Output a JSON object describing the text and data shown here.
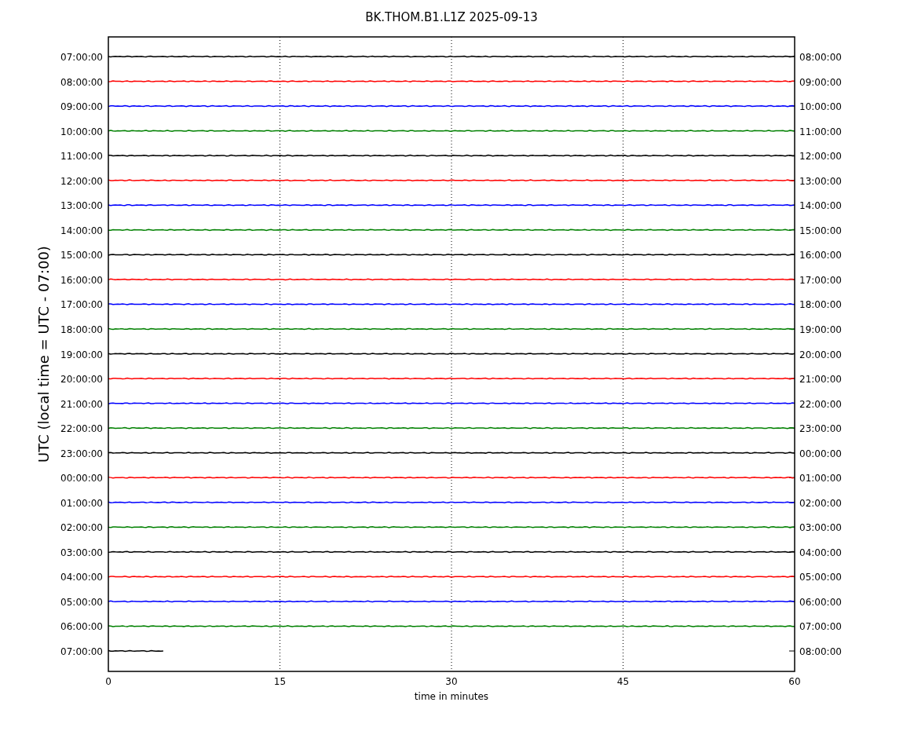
{
  "title": "BK.THOM.B1.L1Z 2025-09-13",
  "ylabel": "UTC (local time = UTC - 07:00)",
  "xlabel": "time in minutes",
  "xticks": [
    "0",
    "15",
    "30",
    "45",
    "60"
  ],
  "rows": [
    {
      "left": "07:00:00",
      "right": "08:00:00",
      "color": "#000000",
      "level": 1
    },
    {
      "left": "08:00:00",
      "right": "09:00:00",
      "color": "#ff0000",
      "level": 1
    },
    {
      "left": "09:00:00",
      "right": "10:00:00",
      "color": "#0000ff",
      "level": 1
    },
    {
      "left": "10:00:00",
      "right": "11:00:00",
      "color": "#008000",
      "level": 1
    },
    {
      "left": "11:00:00",
      "right": "12:00:00",
      "color": "#000000",
      "level": 1
    },
    {
      "left": "12:00:00",
      "right": "13:00:00",
      "color": "#ff0000",
      "level": 1
    },
    {
      "left": "13:00:00",
      "right": "14:00:00",
      "color": "#0000ff",
      "level": 1
    },
    {
      "left": "14:00:00",
      "right": "15:00:00",
      "color": "#008000",
      "level": 1
    },
    {
      "left": "15:00:00",
      "right": "16:00:00",
      "color": "#000000",
      "level": 1
    },
    {
      "left": "16:00:00",
      "right": "17:00:00",
      "color": "#ff0000",
      "level": 1
    },
    {
      "left": "17:00:00",
      "right": "18:00:00",
      "color": "#0000ff",
      "level": 1
    },
    {
      "left": "18:00:00",
      "right": "19:00:00",
      "color": "#008000",
      "level": 1
    },
    {
      "left": "19:00:00",
      "right": "20:00:00",
      "color": "#000000",
      "level": 1
    },
    {
      "left": "20:00:00",
      "right": "21:00:00",
      "color": "#ff0000",
      "level": 1
    },
    {
      "left": "21:00:00",
      "right": "22:00:00",
      "color": "#0000ff",
      "level": 1
    },
    {
      "left": "22:00:00",
      "right": "23:00:00",
      "color": "#008000",
      "level": 1
    },
    {
      "left": "23:00:00",
      "right": "00:00:00",
      "color": "#000000",
      "level": 1
    },
    {
      "left": "00:00:00",
      "right": "01:00:00",
      "color": "#ff0000",
      "level": 1
    },
    {
      "left": "01:00:00",
      "right": "02:00:00",
      "color": "#0000ff",
      "level": 1
    },
    {
      "left": "02:00:00",
      "right": "03:00:00",
      "color": "#008000",
      "level": 1
    },
    {
      "left": "03:00:00",
      "right": "04:00:00",
      "color": "#000000",
      "level": 1
    },
    {
      "left": "04:00:00",
      "right": "05:00:00",
      "color": "#ff0000",
      "level": 1
    },
    {
      "left": "05:00:00",
      "right": "06:00:00",
      "color": "#0000ff",
      "level": 1
    },
    {
      "left": "06:00:00",
      "right": "07:00:00",
      "color": "#008000",
      "level": 1
    },
    {
      "left": "07:00:00",
      "right": "08:00:00",
      "color": "#000000",
      "level": 0.08
    }
  ]
}
